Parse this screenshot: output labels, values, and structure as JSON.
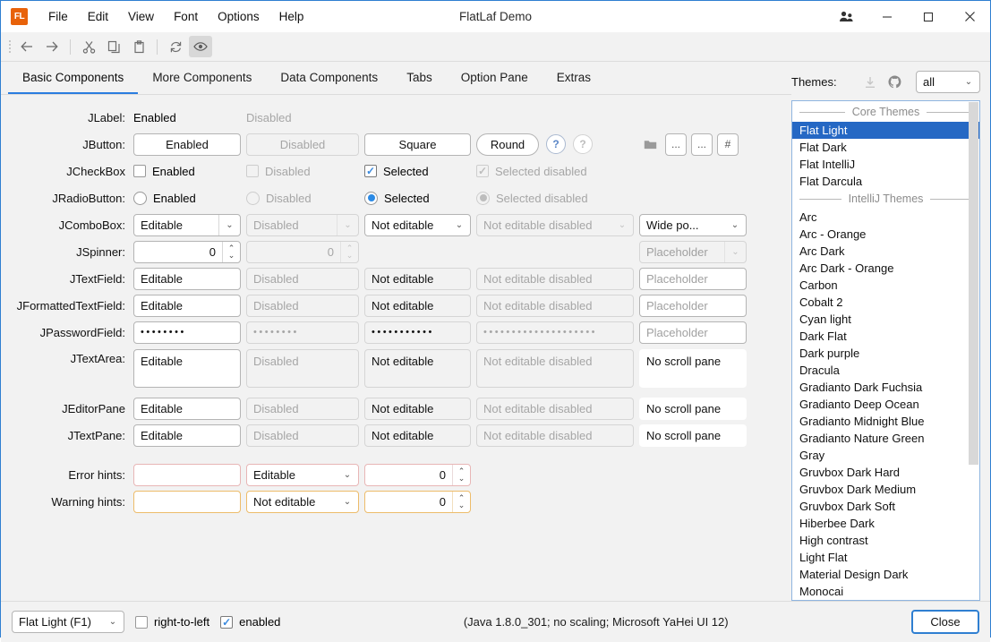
{
  "window": {
    "title": "FlatLaf Demo",
    "logo_text": "FL",
    "controls": [
      {
        "name": "users-icon",
        "glyph": "users"
      },
      {
        "name": "minimize-button",
        "glyph": "minimize"
      },
      {
        "name": "maximize-button",
        "glyph": "maximize"
      },
      {
        "name": "close-button",
        "glyph": "close"
      }
    ]
  },
  "menubar": {
    "items": [
      "File",
      "Edit",
      "View",
      "Font",
      "Options",
      "Help"
    ]
  },
  "toolbar": {
    "items": [
      {
        "name": "back-icon",
        "label": "←",
        "active": false
      },
      {
        "name": "forward-icon",
        "label": "→",
        "active": false
      },
      {
        "name": "cut-icon",
        "label": "cut",
        "active": false
      },
      {
        "name": "copy-icon",
        "label": "copy",
        "active": false
      },
      {
        "name": "paste-icon",
        "label": "paste",
        "active": false
      },
      {
        "name": "refresh-icon",
        "label": "refresh",
        "active": false
      },
      {
        "name": "eye-icon",
        "label": "eye",
        "active": true
      }
    ]
  },
  "tabs": [
    {
      "label": "Basic Components",
      "selected": true
    },
    {
      "label": "More Components",
      "selected": false
    },
    {
      "label": "Data Components",
      "selected": false
    },
    {
      "label": "Tabs",
      "selected": false
    },
    {
      "label": "Option Pane",
      "selected": false
    },
    {
      "label": "Extras",
      "selected": false
    }
  ],
  "form": {
    "labels": {
      "jlabel": "JLabel:",
      "jbutton": "JButton:",
      "jcheckbox": "JCheckBox",
      "jradiobutton": "JRadioButton:",
      "jcombobox": "JComboBox:",
      "jspinner": "JSpinner:",
      "jtextfield": "JTextField:",
      "jformattedtextfield": "JFormattedTextField:",
      "jpasswordfield": "JPasswordField:",
      "jtextarea": "JTextArea:",
      "jeditorpane": "JEditorPane",
      "jtextpane": "JTextPane:",
      "error_hints": "Error hints:",
      "warning_hints": "Warning hints:"
    },
    "jlabel_row": {
      "enabled": "Enabled",
      "disabled": "Disabled"
    },
    "jbutton_row": {
      "enabled": "Enabled",
      "disabled": "Disabled",
      "square": "Square",
      "round": "Round",
      "help_enabled": "?",
      "help_disabled": "?",
      "folder": "folder-icon",
      "dots1": "...",
      "dots2": "...",
      "hash": "#"
    },
    "jcheckbox_row": {
      "enabled": "Enabled",
      "disabled": "Disabled",
      "selected": "Selected",
      "selected_disabled": "Selected disabled"
    },
    "jradiobutton_row": {
      "enabled": "Enabled",
      "disabled": "Disabled",
      "selected": "Selected",
      "selected_disabled": "Selected disabled"
    },
    "jcombobox_row": {
      "editable": "Editable",
      "disabled": "Disabled",
      "not_editable": "Not editable",
      "not_editable_disabled": "Not editable disabled",
      "wide_popup": "Wide po..."
    },
    "jspinner_row": {
      "editable": "0",
      "disabled": "0",
      "placeholder": "Placeholder"
    },
    "jtextfield_row": {
      "editable": "Editable",
      "disabled": "Disabled",
      "not_editable": "Not editable",
      "not_editable_disabled": "Not editable disabled",
      "placeholder": "Placeholder"
    },
    "jformattedtextfield_row": {
      "editable": "Editable",
      "disabled": "Disabled",
      "not_editable": "Not editable",
      "not_editable_disabled": "Not editable disabled",
      "placeholder": "Placeholder"
    },
    "jpasswordfield_row": {
      "editable": "••••••••",
      "disabled": "••••••••",
      "not_editable": "•••••••••••",
      "not_editable_disabled": "••••••••••••••••••••",
      "placeholder": "Placeholder"
    },
    "jtextarea_row": {
      "editable": "Editable",
      "disabled": "Disabled",
      "not_editable": "Not editable",
      "not_editable_disabled": "Not editable disabled",
      "no_scroll_pane": "No scroll pane"
    },
    "jeditorpane_row": {
      "editable": "Editable",
      "disabled": "Disabled",
      "not_editable": "Not editable",
      "not_editable_disabled": "Not editable disabled",
      "no_scroll_pane": "No scroll pane"
    },
    "jtextpane_row": {
      "editable": "Editable",
      "disabled": "Disabled",
      "not_editable": "Not editable",
      "not_editable_disabled": "Not editable disabled",
      "no_scroll_pane": "No scroll pane"
    },
    "error_hints_row": {
      "textfield": "",
      "combo": "Editable",
      "spinner": "0"
    },
    "warning_hints_row": {
      "textfield": "",
      "combo": "Not editable",
      "spinner": "0"
    }
  },
  "themes_panel": {
    "title": "Themes:",
    "download_icon": "download-icon",
    "github_icon": "github-icon",
    "filter_value": "all",
    "groups": [
      {
        "separator": "Core Themes",
        "items": [
          "Flat Light",
          "Flat Dark",
          "Flat IntelliJ",
          "Flat Darcula"
        ]
      },
      {
        "separator": "IntelliJ Themes",
        "items": [
          "Arc",
          "Arc - Orange",
          "Arc Dark",
          "Arc Dark - Orange",
          "Carbon",
          "Cobalt 2",
          "Cyan light",
          "Dark Flat",
          "Dark purple",
          "Dracula",
          "Gradianto Dark Fuchsia",
          "Gradianto Deep Ocean",
          "Gradianto Midnight Blue",
          "Gradianto Nature Green",
          "Gray",
          "Gruvbox Dark Hard",
          "Gruvbox Dark Medium",
          "Gruvbox Dark Soft",
          "Hiberbee Dark",
          "High contrast",
          "Light Flat",
          "Material Design Dark",
          "Monocai"
        ]
      }
    ],
    "selected_theme": "Flat Light"
  },
  "statusbar": {
    "theme_value": "Flat Light (F1)",
    "right_to_left_label": "right-to-left",
    "right_to_left_checked": false,
    "enabled_label": "enabled",
    "enabled_checked": true,
    "java_info": "(Java 1.8.0_301; no scaling; Microsoft YaHei UI 12)",
    "close_label": "Close"
  },
  "colors": {
    "accent": "#2568c4",
    "tab_underline": "#2b7de0",
    "window_border": "#2f7fd1",
    "error_border": "#e8b6b6",
    "warning_border": "#edbc6a",
    "logo_bg": "#e8620a"
  }
}
